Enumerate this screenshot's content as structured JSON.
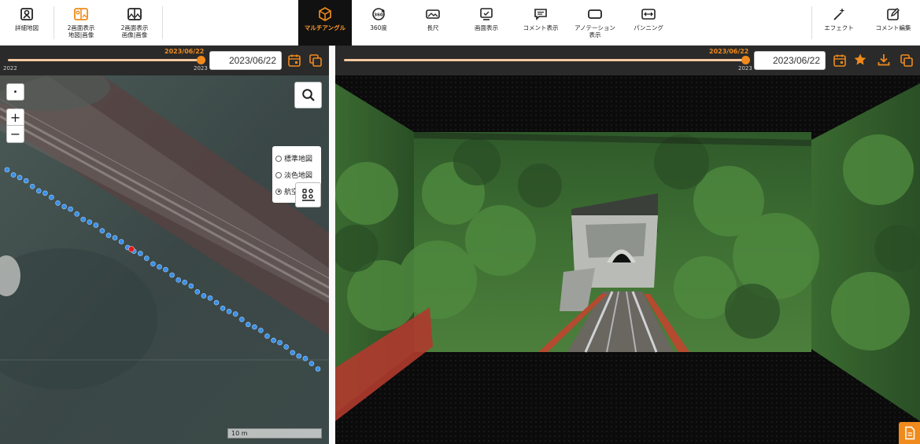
{
  "toolbar": {
    "items": [
      {
        "label": "詳細地図",
        "icon": "map-detail-icon"
      },
      {
        "label": "2画面表示\n地図|画像",
        "icon": "split-map-image-icon"
      },
      {
        "label": "2画面表示\n画像|画像",
        "icon": "split-image-image-icon"
      },
      {
        "label": "マルチアングル",
        "icon": "cube-icon",
        "active": true
      },
      {
        "label": "360度",
        "icon": "rotate-360-icon"
      },
      {
        "label": "長尺",
        "icon": "panorama-icon"
      },
      {
        "label": "画面表示",
        "icon": "monitor-check-icon"
      },
      {
        "label": "コメント表示",
        "icon": "comment-icon"
      },
      {
        "label": "アノテーション\n表示",
        "icon": "annotation-box-icon"
      },
      {
        "label": "パンニング",
        "icon": "panning-arrows-icon"
      },
      {
        "label": "エフェクト",
        "icon": "magic-wand-icon"
      },
      {
        "label": "コメント編集",
        "icon": "edit-comment-icon"
      }
    ]
  },
  "left": {
    "timeline": {
      "current": "2023/06/22",
      "start": "2022",
      "end": "2023",
      "progress": 1.0
    },
    "date_value": "2023/06/22"
  },
  "right": {
    "timeline": {
      "current": "2023/06/22",
      "end": "2023",
      "progress": 1.0
    },
    "date_value": "2023/06/22"
  },
  "map": {
    "zoom_in": "+",
    "zoom_out": "−",
    "locate": "•",
    "layers": [
      {
        "label": "標準地図",
        "checked": false
      },
      {
        "label": "淡色地図",
        "checked": false
      },
      {
        "label": "航空写真",
        "checked": true
      }
    ],
    "scale_label": "10 m"
  },
  "colors": {
    "accent": "#f08a1c",
    "track_point": "#3a8fe8",
    "current_point": "#e11a1a",
    "toolbar_active_bg": "#111111"
  }
}
